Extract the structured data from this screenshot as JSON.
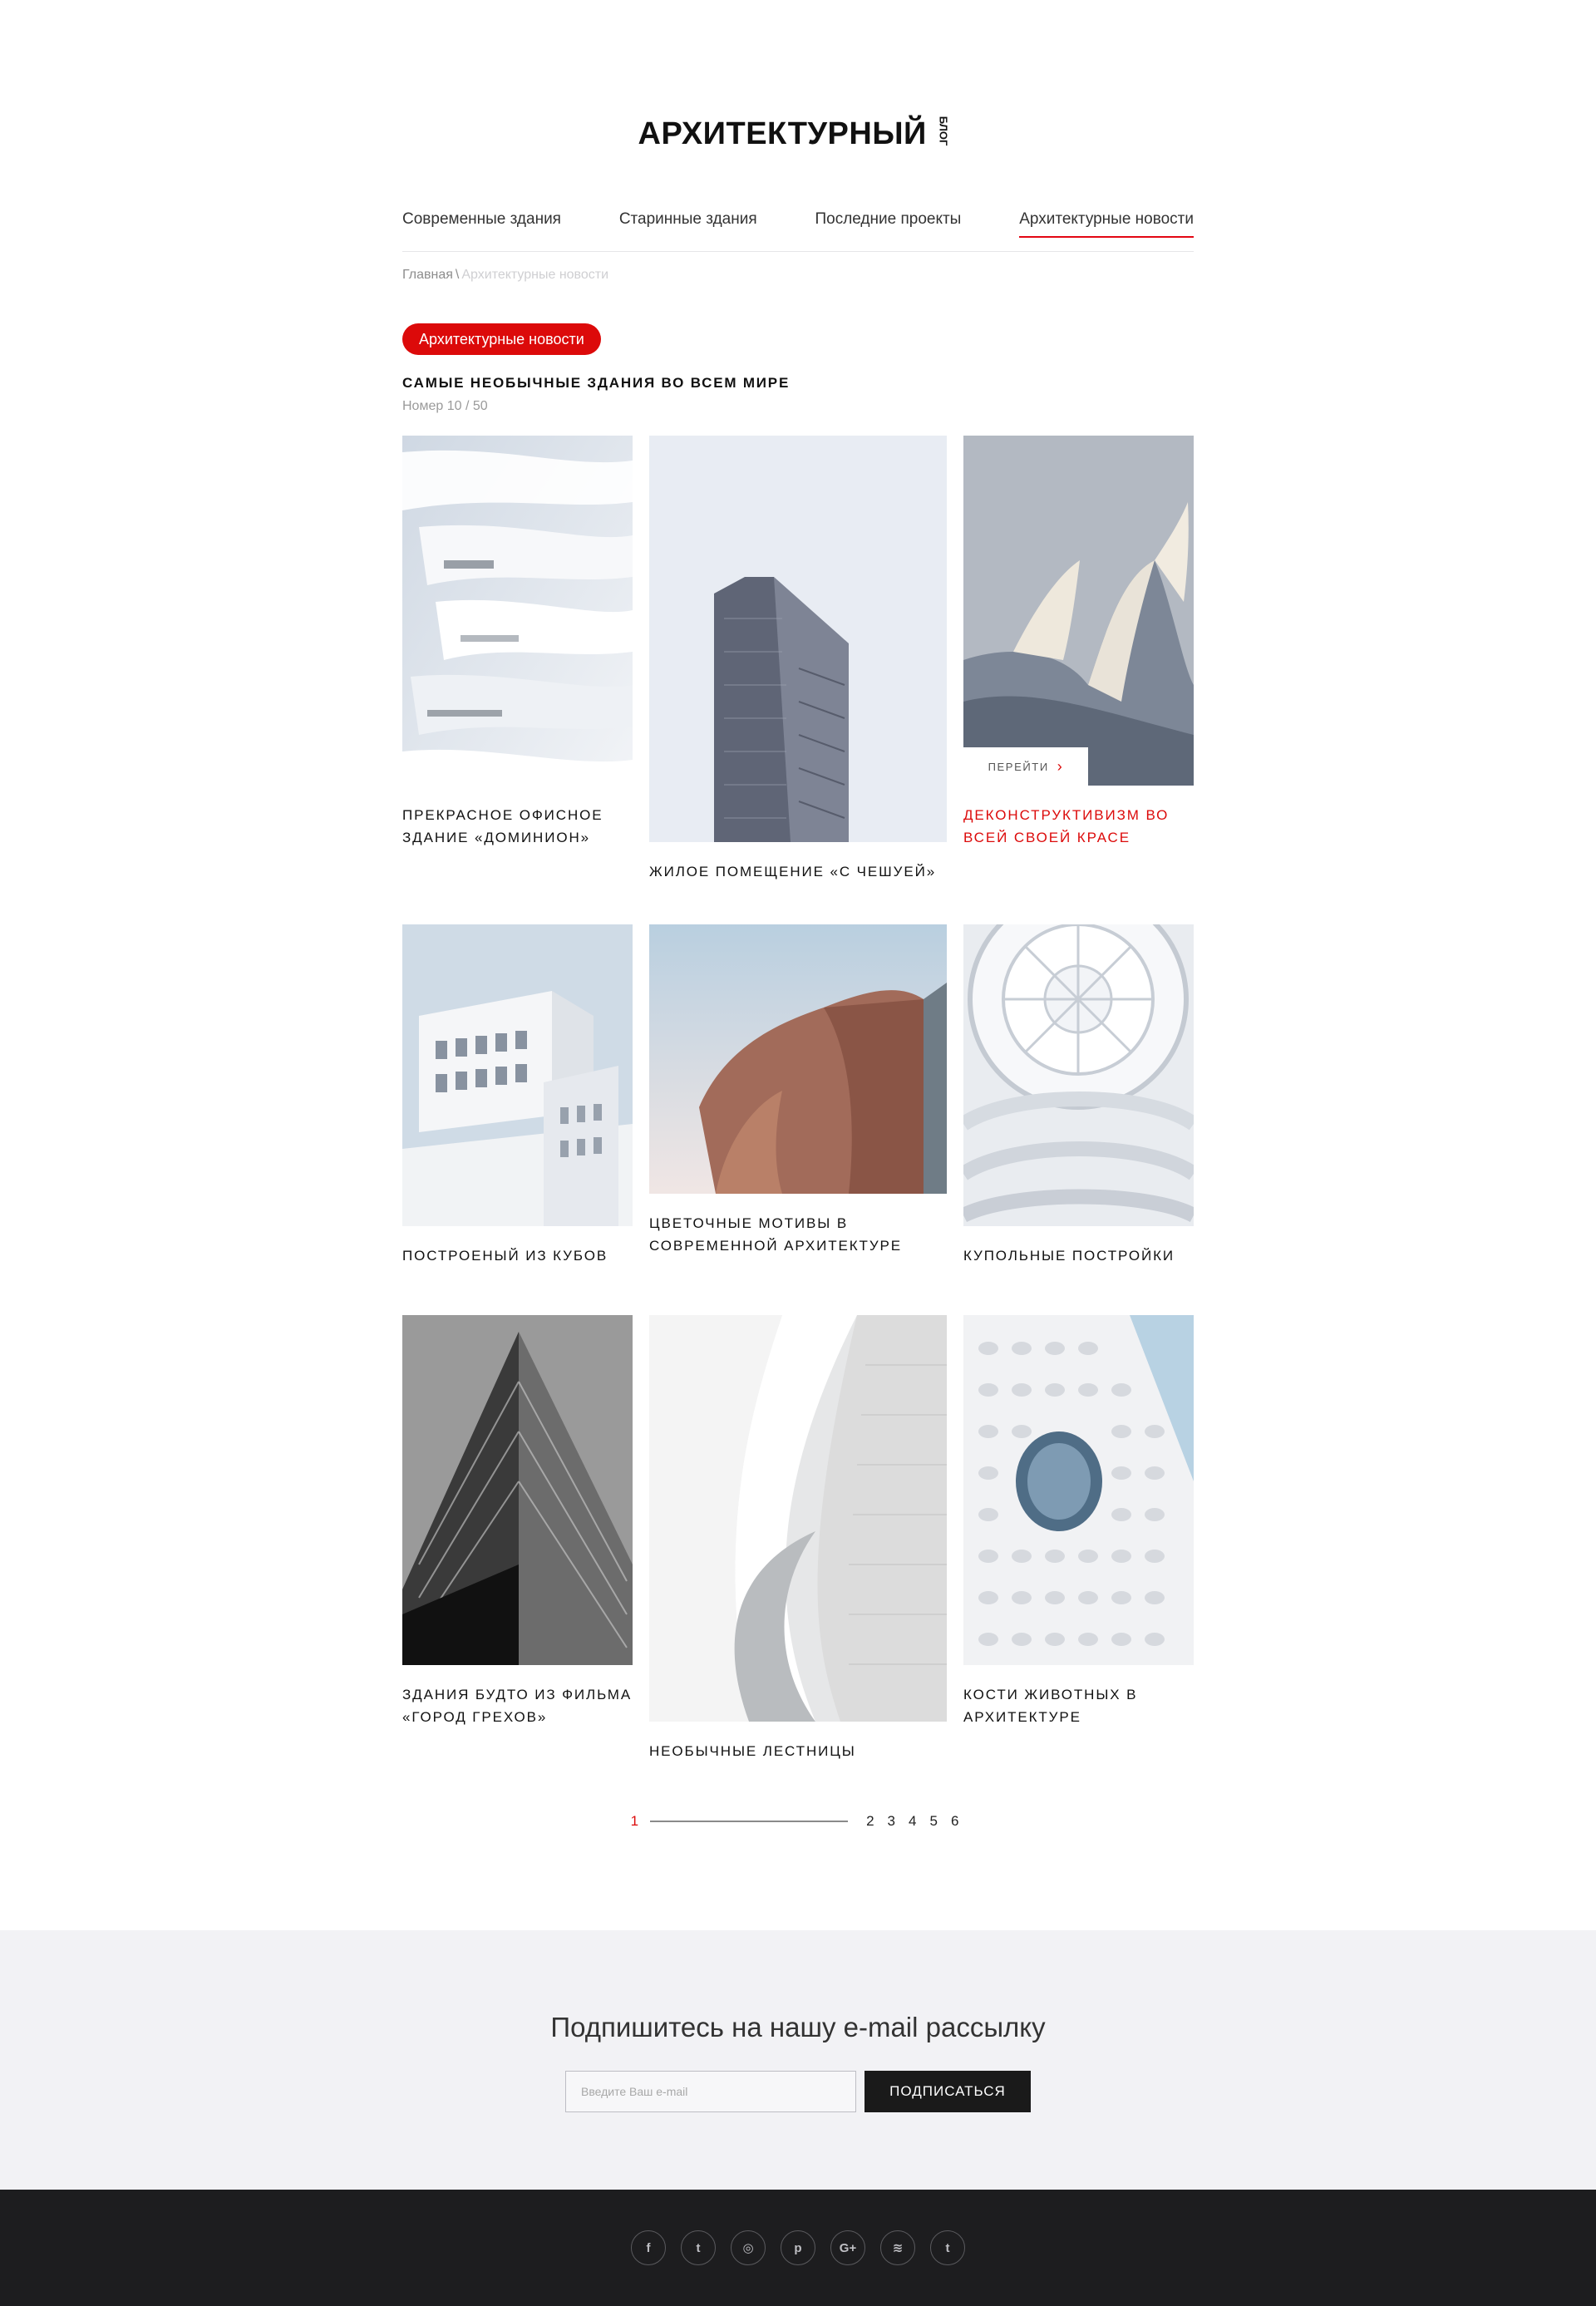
{
  "logo": {
    "main": "АРХИТЕКТУРНЫЙ",
    "sub": "БЛОГ"
  },
  "nav": {
    "items": [
      "Современные здания",
      "Старинные здания",
      "Последние проекты",
      "Архитектурные новости"
    ]
  },
  "breadcrumb": {
    "home": "Главная",
    "separator": "\\",
    "current": "Архитектурные новости"
  },
  "tag": "Архитектурные новости",
  "article": {
    "title": "САМЫЕ НЕОБЫЧНЫЕ ЗДАНИЯ ВО ВСЕМ МИРЕ",
    "issue": "Номер 10 / 50"
  },
  "cards": [
    {
      "caption": "Прекрасное офисное здание «Доминион»",
      "icon": "spiral-balconies-image"
    },
    {
      "caption": "Жилое помещение «С чешуей»",
      "icon": "tower-image"
    },
    {
      "caption": "Деконструктивизм во всей своей красе",
      "icon": "opera-shells-image",
      "goto": "ПЕРЕЙТИ"
    },
    {
      "caption": "Построеный из кубов",
      "icon": "cube-building-image"
    },
    {
      "caption": "Цветочные мотивы в современной архитектуре",
      "icon": "flower-building-image"
    },
    {
      "caption": "Купольные постройки",
      "icon": "dome-interior-image"
    },
    {
      "caption": "Здания будто из фильма «Город грехов»",
      "icon": "bw-skyscraper-image"
    },
    {
      "caption": "Необычные лестницы",
      "icon": "spiral-staircase-image"
    },
    {
      "caption": "Кости животных в архитектуре",
      "icon": "honeycomb-facade-image"
    }
  ],
  "pagination": {
    "current": "1",
    "pages": [
      "2",
      "3",
      "4",
      "5",
      "6"
    ]
  },
  "newsletter": {
    "title": "Подпишитесь на нашу e-mail рассылку",
    "placeholder": "Введите Ваш e-mail",
    "button": "ПОДПИСАТЬСЯ"
  },
  "footer": {
    "social": [
      {
        "name": "facebook-icon",
        "glyph": "f"
      },
      {
        "name": "twitter-icon",
        "glyph": "t"
      },
      {
        "name": "instagram-icon",
        "glyph": "◎"
      },
      {
        "name": "pinterest-icon",
        "glyph": "p"
      },
      {
        "name": "google-plus-icon",
        "glyph": "G+"
      },
      {
        "name": "spotify-icon",
        "glyph": "≋"
      },
      {
        "name": "tumblr-icon",
        "glyph": "t"
      }
    ]
  },
  "colors": {
    "accent": "#dc0a0a",
    "footer": "#1d1d1f",
    "newsletter_bg": "#f2f2f5"
  }
}
